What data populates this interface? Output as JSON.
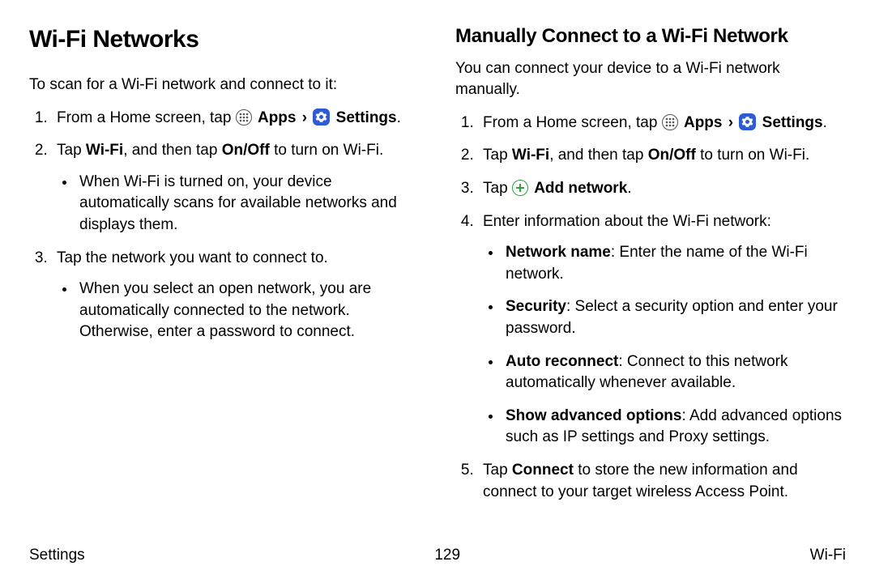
{
  "left": {
    "title": "Wi-Fi Networks",
    "intro": "To scan for a Wi-Fi network and connect to it:",
    "step1_pre": "From a Home screen, tap ",
    "apps": "Apps",
    "chevron": "›",
    "settings": "Settings",
    "period": ".",
    "step2_a": "Tap ",
    "step2_b": "Wi-Fi",
    "step2_c": ", and then tap ",
    "step2_d": "On/Off",
    "step2_e": " to turn on Wi-Fi.",
    "step2_bullet": "When Wi-Fi is turned on, your device automatically scans for available networks and displays them.",
    "step3": "Tap the network you want to connect to.",
    "step3_bullet": "When you select an open network, you are automatically connected to the network. Otherwise, enter a password to connect."
  },
  "right": {
    "title": "Manually Connect to a Wi-Fi Network",
    "intro": "You can connect your device to a Wi-Fi network manually.",
    "step1_pre": "From a Home screen, tap ",
    "apps": "Apps",
    "chevron": "›",
    "settings": "Settings",
    "period": ".",
    "step2_a": "Tap ",
    "step2_b": "Wi-Fi",
    "step2_c": ", and then tap ",
    "step2_d": "On/Off",
    "step2_e": " to turn on Wi-Fi.",
    "step3_a": "Tap ",
    "step3_b": "Add network",
    "step3_c": ".",
    "step4": "Enter information about the Wi-Fi network:",
    "b1_label": "Network name",
    "b1_text": ": Enter the name of the Wi-Fi network.",
    "b2_label": "Security",
    "b2_text": ": Select a security option and enter your password.",
    "b3_label": "Auto reconnect",
    "b3_text": ": Connect to this network automatically whenever available.",
    "b4_label": "Show advanced options",
    "b4_text": ": Add advanced options such as IP settings and Proxy settings.",
    "step5_a": "Tap ",
    "step5_b": "Connect",
    "step5_c": " to store the new information and connect to your target wireless Access Point."
  },
  "footer": {
    "left": "Settings",
    "center": "129",
    "right": "Wi-Fi"
  }
}
